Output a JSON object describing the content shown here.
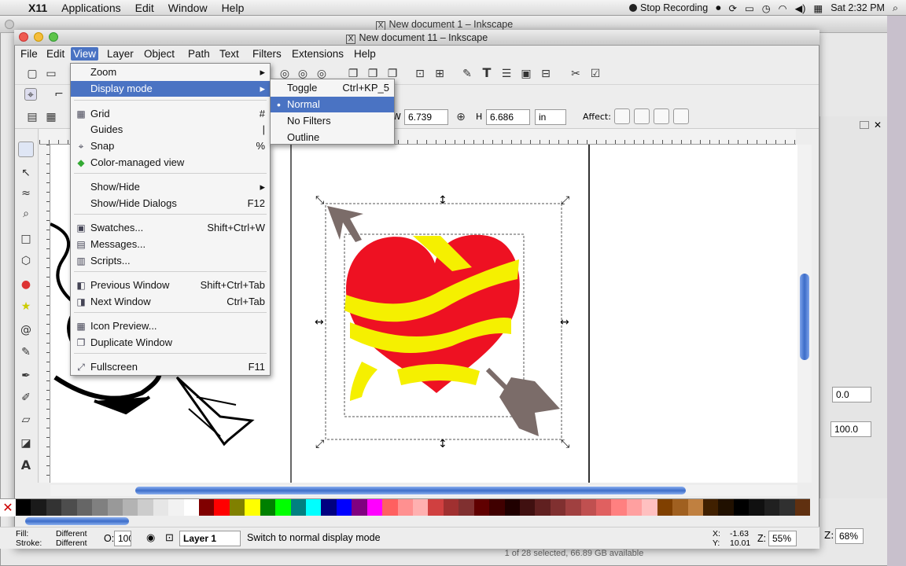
{
  "mac_menubar": {
    "apple": "",
    "app": "X11",
    "items": [
      "Applications",
      "Edit",
      "Window",
      "Help"
    ],
    "stop_recording": "Stop Recording",
    "clock": "Sat 2:32 PM"
  },
  "background_window": {
    "title": "New document 1 – Inkscape",
    "status": "1 of 28 selected, 66.89 GB available"
  },
  "window": {
    "title": "New document 11 – Inkscape"
  },
  "menubar": [
    "File",
    "Edit",
    "View",
    "Layer",
    "Object",
    "Path",
    "Text",
    "Filters",
    "Extensions",
    "Help"
  ],
  "view_menu": {
    "items": [
      {
        "label": "Zoom",
        "accel": "▸",
        "icon": ""
      },
      {
        "label": "Display mode",
        "accel": "▸",
        "icon": "",
        "highlighted": true
      },
      {
        "label": "Grid",
        "accel": "#",
        "icon": "grid-icon"
      },
      {
        "label": "Guides",
        "accel": "|",
        "icon": ""
      },
      {
        "label": "Snap",
        "accel": "%",
        "icon": "snap-icon"
      },
      {
        "label": "Color-managed view",
        "accel": "",
        "icon": "color-managed-icon"
      },
      {
        "label": "Show/Hide",
        "accel": "▸",
        "icon": ""
      },
      {
        "label": "Show/Hide Dialogs",
        "accel": "F12",
        "icon": ""
      },
      {
        "label": "Swatches...",
        "accel": "Shift+Ctrl+W",
        "icon": "swatches-icon"
      },
      {
        "label": "Messages...",
        "accel": "",
        "icon": "messages-icon"
      },
      {
        "label": "Scripts...",
        "accel": "",
        "icon": "scripts-icon"
      },
      {
        "label": "Previous Window",
        "accel": "Shift+Ctrl+Tab",
        "icon": "previous-window-icon"
      },
      {
        "label": "Next Window",
        "accel": "Ctrl+Tab",
        "icon": "next-window-icon"
      },
      {
        "label": "Icon Preview...",
        "accel": "",
        "icon": "icon-preview-icon"
      },
      {
        "label": "Duplicate Window",
        "accel": "",
        "icon": "duplicate-window-icon"
      },
      {
        "label": "Fullscreen",
        "accel": "F11",
        "icon": "fullscreen-icon"
      }
    ]
  },
  "display_submenu": {
    "items": [
      {
        "label": "Toggle",
        "accel": "Ctrl+KP_5"
      },
      {
        "label": "Normal",
        "accel": "",
        "selected": true
      },
      {
        "label": "No Filters",
        "accel": ""
      },
      {
        "label": "Outline",
        "accel": ""
      }
    ]
  },
  "tool_controls": {
    "w_label": "W",
    "w_value": "6.739",
    "h_label": "H",
    "h_value": "6.686",
    "unit": "in",
    "affect_label": "Affect:"
  },
  "dock": {
    "value1": "0.0",
    "value2": "100.0"
  },
  "status": {
    "fill_label": "Fill:",
    "fill_value": "Different",
    "stroke_label": "Stroke:",
    "stroke_value": "Different",
    "opacity_label": "O:",
    "opacity_value": "100",
    "layer": "Layer 1",
    "message": "Switch to normal display mode",
    "x_label": "X:",
    "x_value": "-1.63",
    "y_label": "Y:",
    "y_value": "10.01",
    "zoom_label": "Z:",
    "zoom_value": "55%",
    "bg_zoom_value": "68%"
  },
  "palette_colors": [
    "#000000",
    "#1a1a1a",
    "#333333",
    "#4d4d4d",
    "#666666",
    "#808080",
    "#999999",
    "#b3b3b3",
    "#cccccc",
    "#e6e6e6",
    "#f2f2f2",
    "#ffffff",
    "#800000",
    "#ff0000",
    "#808000",
    "#ffff00",
    "#008000",
    "#00ff00",
    "#008080",
    "#00ffff",
    "#000080",
    "#0000ff",
    "#800080",
    "#ff00ff",
    "#ff6060",
    "#ff9090",
    "#ffb0b0",
    "#d04040",
    "#a03030",
    "#803030",
    "#600000",
    "#400000",
    "#200000",
    "#401010",
    "#602020",
    "#803030",
    "#a04040",
    "#c05050",
    "#e06060",
    "#ff8080",
    "#ffa0a0",
    "#ffc0c0",
    "#804000",
    "#a06020",
    "#c08040",
    "#402000",
    "#201000",
    "#000000",
    "#101010",
    "#202020",
    "#303030",
    "#603010"
  ]
}
